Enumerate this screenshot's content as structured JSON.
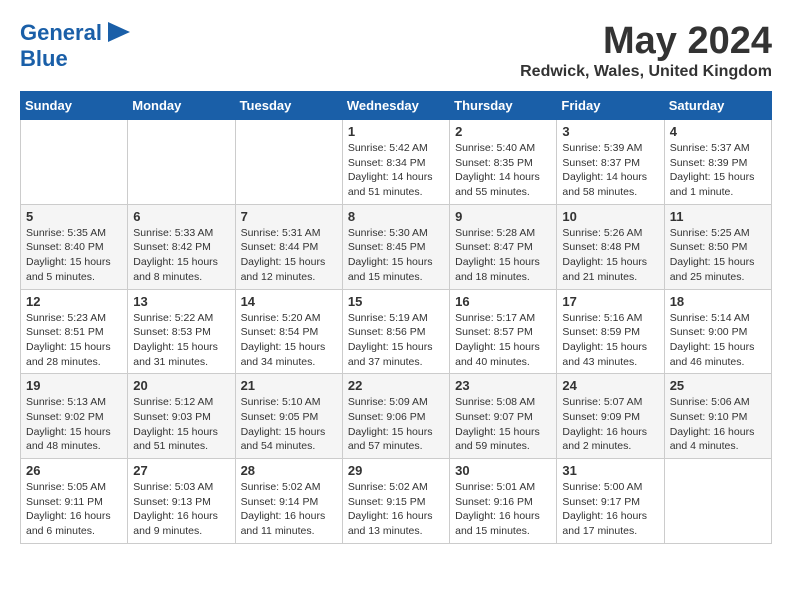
{
  "header": {
    "logo_line1": "General",
    "logo_line2": "Blue",
    "month_title": "May 2024",
    "location": "Redwick, Wales, United Kingdom"
  },
  "days_of_week": [
    "Sunday",
    "Monday",
    "Tuesday",
    "Wednesday",
    "Thursday",
    "Friday",
    "Saturday"
  ],
  "weeks": [
    [
      {
        "day": "",
        "info": ""
      },
      {
        "day": "",
        "info": ""
      },
      {
        "day": "",
        "info": ""
      },
      {
        "day": "1",
        "info": "Sunrise: 5:42 AM\nSunset: 8:34 PM\nDaylight: 14 hours\nand 51 minutes."
      },
      {
        "day": "2",
        "info": "Sunrise: 5:40 AM\nSunset: 8:35 PM\nDaylight: 14 hours\nand 55 minutes."
      },
      {
        "day": "3",
        "info": "Sunrise: 5:39 AM\nSunset: 8:37 PM\nDaylight: 14 hours\nand 58 minutes."
      },
      {
        "day": "4",
        "info": "Sunrise: 5:37 AM\nSunset: 8:39 PM\nDaylight: 15 hours\nand 1 minute."
      }
    ],
    [
      {
        "day": "5",
        "info": "Sunrise: 5:35 AM\nSunset: 8:40 PM\nDaylight: 15 hours\nand 5 minutes."
      },
      {
        "day": "6",
        "info": "Sunrise: 5:33 AM\nSunset: 8:42 PM\nDaylight: 15 hours\nand 8 minutes."
      },
      {
        "day": "7",
        "info": "Sunrise: 5:31 AM\nSunset: 8:44 PM\nDaylight: 15 hours\nand 12 minutes."
      },
      {
        "day": "8",
        "info": "Sunrise: 5:30 AM\nSunset: 8:45 PM\nDaylight: 15 hours\nand 15 minutes."
      },
      {
        "day": "9",
        "info": "Sunrise: 5:28 AM\nSunset: 8:47 PM\nDaylight: 15 hours\nand 18 minutes."
      },
      {
        "day": "10",
        "info": "Sunrise: 5:26 AM\nSunset: 8:48 PM\nDaylight: 15 hours\nand 21 minutes."
      },
      {
        "day": "11",
        "info": "Sunrise: 5:25 AM\nSunset: 8:50 PM\nDaylight: 15 hours\nand 25 minutes."
      }
    ],
    [
      {
        "day": "12",
        "info": "Sunrise: 5:23 AM\nSunset: 8:51 PM\nDaylight: 15 hours\nand 28 minutes."
      },
      {
        "day": "13",
        "info": "Sunrise: 5:22 AM\nSunset: 8:53 PM\nDaylight: 15 hours\nand 31 minutes."
      },
      {
        "day": "14",
        "info": "Sunrise: 5:20 AM\nSunset: 8:54 PM\nDaylight: 15 hours\nand 34 minutes."
      },
      {
        "day": "15",
        "info": "Sunrise: 5:19 AM\nSunset: 8:56 PM\nDaylight: 15 hours\nand 37 minutes."
      },
      {
        "day": "16",
        "info": "Sunrise: 5:17 AM\nSunset: 8:57 PM\nDaylight: 15 hours\nand 40 minutes."
      },
      {
        "day": "17",
        "info": "Sunrise: 5:16 AM\nSunset: 8:59 PM\nDaylight: 15 hours\nand 43 minutes."
      },
      {
        "day": "18",
        "info": "Sunrise: 5:14 AM\nSunset: 9:00 PM\nDaylight: 15 hours\nand 46 minutes."
      }
    ],
    [
      {
        "day": "19",
        "info": "Sunrise: 5:13 AM\nSunset: 9:02 PM\nDaylight: 15 hours\nand 48 minutes."
      },
      {
        "day": "20",
        "info": "Sunrise: 5:12 AM\nSunset: 9:03 PM\nDaylight: 15 hours\nand 51 minutes."
      },
      {
        "day": "21",
        "info": "Sunrise: 5:10 AM\nSunset: 9:05 PM\nDaylight: 15 hours\nand 54 minutes."
      },
      {
        "day": "22",
        "info": "Sunrise: 5:09 AM\nSunset: 9:06 PM\nDaylight: 15 hours\nand 57 minutes."
      },
      {
        "day": "23",
        "info": "Sunrise: 5:08 AM\nSunset: 9:07 PM\nDaylight: 15 hours\nand 59 minutes."
      },
      {
        "day": "24",
        "info": "Sunrise: 5:07 AM\nSunset: 9:09 PM\nDaylight: 16 hours\nand 2 minutes."
      },
      {
        "day": "25",
        "info": "Sunrise: 5:06 AM\nSunset: 9:10 PM\nDaylight: 16 hours\nand 4 minutes."
      }
    ],
    [
      {
        "day": "26",
        "info": "Sunrise: 5:05 AM\nSunset: 9:11 PM\nDaylight: 16 hours\nand 6 minutes."
      },
      {
        "day": "27",
        "info": "Sunrise: 5:03 AM\nSunset: 9:13 PM\nDaylight: 16 hours\nand 9 minutes."
      },
      {
        "day": "28",
        "info": "Sunrise: 5:02 AM\nSunset: 9:14 PM\nDaylight: 16 hours\nand 11 minutes."
      },
      {
        "day": "29",
        "info": "Sunrise: 5:02 AM\nSunset: 9:15 PM\nDaylight: 16 hours\nand 13 minutes."
      },
      {
        "day": "30",
        "info": "Sunrise: 5:01 AM\nSunset: 9:16 PM\nDaylight: 16 hours\nand 15 minutes."
      },
      {
        "day": "31",
        "info": "Sunrise: 5:00 AM\nSunset: 9:17 PM\nDaylight: 16 hours\nand 17 minutes."
      },
      {
        "day": "",
        "info": ""
      }
    ]
  ]
}
